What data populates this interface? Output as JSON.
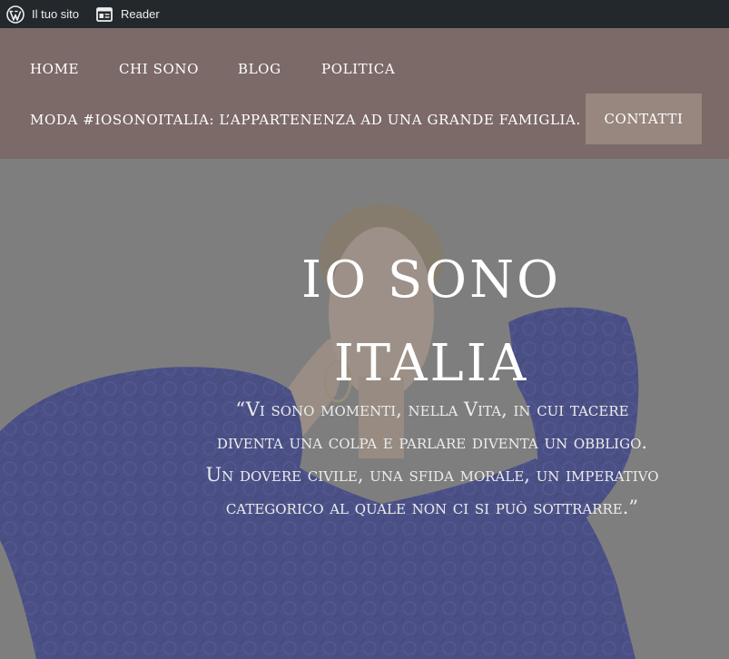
{
  "admin_bar": {
    "site_label": "Il tuo sito",
    "reader_label": "Reader",
    "bg_color": "#23282d",
    "site_icon": "wordpress-icon",
    "reader_icon": "reader-icon"
  },
  "nav": {
    "items": [
      {
        "label": "HOME"
      },
      {
        "label": "CHI SONO"
      },
      {
        "label": "BLOG"
      },
      {
        "label": "POLITICA"
      },
      {
        "label": "MODA #IOSONOITALIA: L’APPARTENENZA AD UNA GRANDE FAMIGLIA."
      }
    ],
    "cta_label": "CONTATTI",
    "bg_color": "#7c6a68",
    "cta_color": "#98877f"
  },
  "hero": {
    "title_line1": "IO SONO",
    "title_line2": "ITALIA",
    "quote": "“Vi sono momenti, nella Vita, in cui tacere diventa una colpa e parlare diventa un obbligo. Un dovere civile, una sfida morale, un imperativo categorico al quale non ci si può sottrarre.”",
    "overlay_color": "#7e7e7e",
    "dress_color": "#1f2a8c"
  }
}
